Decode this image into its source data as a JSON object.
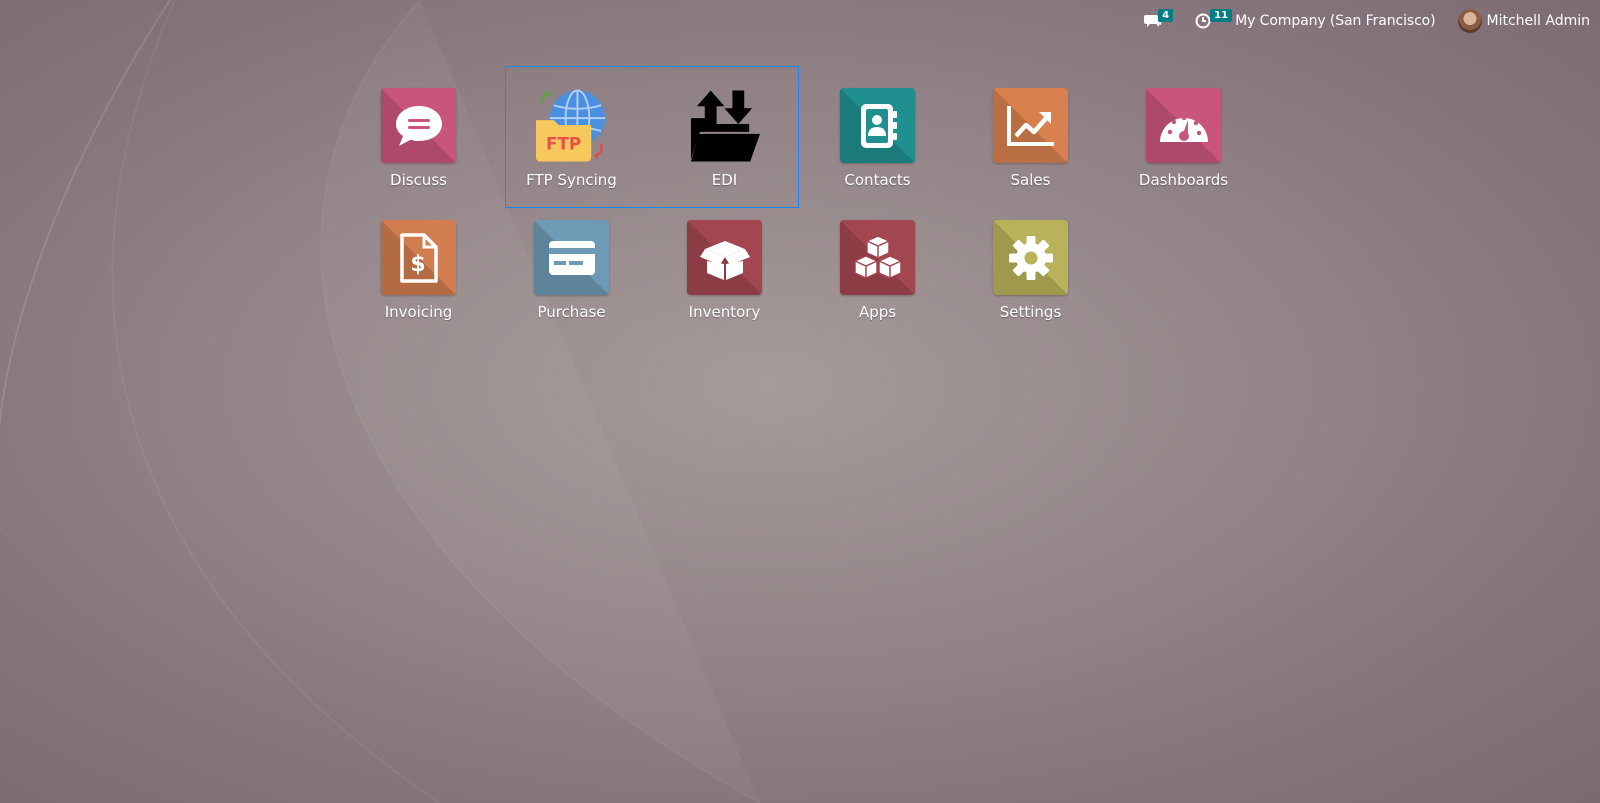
{
  "systray": {
    "messages_badge": "4",
    "activities_badge": "11",
    "company": "My Company (San Francisco)",
    "user_name": "Mitchell Admin"
  },
  "apps": [
    {
      "label": "Discuss",
      "icon": "chat-bubble-icon",
      "color": "#c9557b"
    },
    {
      "label": "FTP Syncing",
      "icon": "ftp-folder-globe-icon"
    },
    {
      "label": "EDI",
      "icon": "folder-upload-download-icon"
    },
    {
      "label": "Contacts",
      "icon": "address-book-icon",
      "color": "#1f8f8f"
    },
    {
      "label": "Sales",
      "icon": "chart-line-up-icon",
      "color": "#d8804e"
    },
    {
      "label": "Dashboards",
      "icon": "speedometer-icon",
      "color": "#c9557b"
    },
    {
      "label": "Invoicing",
      "icon": "invoice-dollar-icon",
      "color": "#d17d4f"
    },
    {
      "label": "Purchase",
      "icon": "credit-card-icon",
      "color": "#6e9ab5"
    },
    {
      "label": "Inventory",
      "icon": "open-box-icon",
      "color": "#a24650"
    },
    {
      "label": "Apps",
      "icon": "cubes-icon",
      "color": "#a24650"
    },
    {
      "label": "Settings",
      "icon": "gear-icon",
      "color": "#b8b25a"
    }
  ]
}
